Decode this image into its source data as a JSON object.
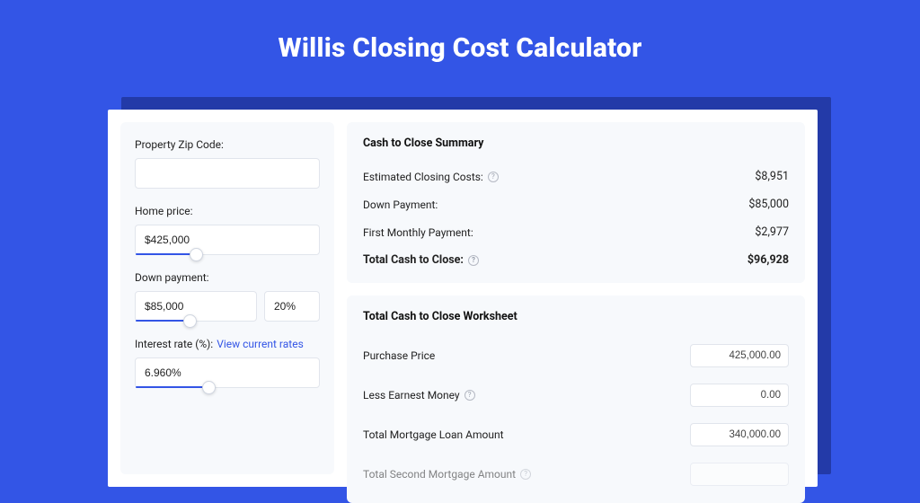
{
  "title": "Willis Closing Cost Calculator",
  "sidebar": {
    "zip_label": "Property Zip Code:",
    "zip_value": "",
    "price_label": "Home price:",
    "price_value": "$425,000",
    "price_fill_pct": 33,
    "down_label": "Down payment:",
    "down_value": "$85,000",
    "down_pct_value": "20%",
    "down_fill_pct": 45,
    "rate_label": "Interest rate (%):",
    "rate_link": "View current rates",
    "rate_value": "6.960%",
    "rate_fill_pct": 40
  },
  "summary": {
    "heading": "Cash to Close Summary",
    "rows": [
      {
        "label": "Estimated Closing Costs:",
        "value": "$8,951",
        "help": true
      },
      {
        "label": "Down Payment:",
        "value": "$85,000",
        "help": false
      },
      {
        "label": "First Monthly Payment:",
        "value": "$2,977",
        "help": false
      }
    ],
    "total_label": "Total Cash to Close:",
    "total_value": "$96,928"
  },
  "worksheet": {
    "heading": "Total Cash to Close Worksheet",
    "rows": [
      {
        "label": "Purchase Price",
        "value": "425,000.00",
        "help": false
      },
      {
        "label": "Less Earnest Money",
        "value": "0.00",
        "help": true
      },
      {
        "label": "Total Mortgage Loan Amount",
        "value": "340,000.00",
        "help": false
      },
      {
        "label": "Total Second Mortgage Amount",
        "value": "",
        "help": true
      }
    ]
  }
}
